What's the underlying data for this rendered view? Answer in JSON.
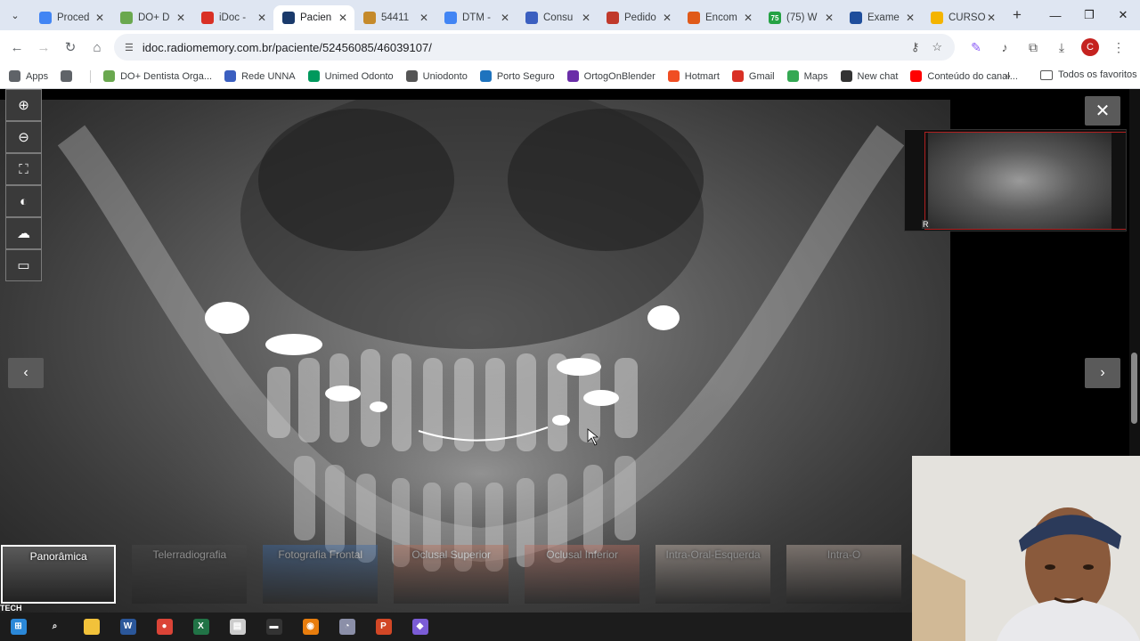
{
  "browser": {
    "tabs": [
      {
        "title": "Proced",
        "favicon": "docs-icon",
        "color": "#4285f4",
        "active": false
      },
      {
        "title": "DO+ D",
        "favicon": "tooth-icon",
        "color": "#6aa84f",
        "active": false
      },
      {
        "title": "iDoc -",
        "favicon": "gmail-icon",
        "color": "#d93025",
        "active": false
      },
      {
        "title": "Pacien",
        "favicon": "idoc-icon",
        "color": "#1a3a6b",
        "active": true
      },
      {
        "title": "54411",
        "favicon": "chart-icon",
        "color": "#c58a2b",
        "active": false
      },
      {
        "title": "DTM -",
        "favicon": "docs-icon",
        "color": "#4285f4",
        "active": false
      },
      {
        "title": "Consu",
        "favicon": "shield-icon",
        "color": "#3b5fc0",
        "active": false
      },
      {
        "title": "Pedido",
        "favicon": "flag-icon",
        "color": "#c0392b",
        "active": false
      },
      {
        "title": "Encom",
        "favicon": "mail-icon",
        "color": "#e05a1a",
        "active": false
      },
      {
        "title": "(75) W",
        "favicon": "whatsapp-icon",
        "color": "#25a244",
        "badge": "75",
        "active": false
      },
      {
        "title": "Exame",
        "favicon": "t-icon",
        "color": "#1f4e9c",
        "active": false
      },
      {
        "title": "CURSO",
        "favicon": "drive-icon",
        "color": "#f4b400",
        "active": false
      }
    ],
    "url": "idoc.radiomemory.com.br/paciente/52456085/46039107/",
    "avatar_letter": "C",
    "bookmarks": [
      {
        "label": "Apps",
        "icon": "apps-grid-icon",
        "color": "#5f6368"
      },
      {
        "label": "",
        "icon": "grid-icon",
        "color": "#5f6368"
      },
      {
        "label": "DO+ Dentista Orga...",
        "icon": "tooth-icon",
        "color": "#6aa84f"
      },
      {
        "label": "Rede UNNA",
        "icon": "shield-icon",
        "color": "#3b5fc0"
      },
      {
        "label": "Unimed Odonto",
        "icon": "unimed-icon",
        "color": "#00995d"
      },
      {
        "label": "Uniodonto",
        "icon": "globe-icon",
        "color": "#555555"
      },
      {
        "label": "Porto Seguro",
        "icon": "porto-icon",
        "color": "#1e73be"
      },
      {
        "label": "OrtogOnBlender",
        "icon": "blender-icon",
        "color": "#6a2ea8"
      },
      {
        "label": "Hotmart",
        "icon": "flame-icon",
        "color": "#f04e23"
      },
      {
        "label": "Gmail",
        "icon": "gmail-icon",
        "color": "#d93025"
      },
      {
        "label": "Maps",
        "icon": "maps-pin-icon",
        "color": "#34a853"
      },
      {
        "label": "New chat",
        "icon": "openai-icon",
        "color": "#333333"
      },
      {
        "label": "Conteúdo do canal...",
        "icon": "youtube-icon",
        "color": "#ff0000"
      }
    ],
    "bookmarks_more": "»",
    "all_bookmarks": "Todos os favoritos"
  },
  "viewer": {
    "tools": [
      {
        "name": "zoom-in-icon",
        "glyph": "⊕"
      },
      {
        "name": "zoom-out-icon",
        "glyph": "⊖"
      },
      {
        "name": "fit-screen-icon",
        "glyph": "⛶"
      },
      {
        "name": "brightness-icon",
        "glyph": "◐"
      },
      {
        "name": "download-cloud-icon",
        "glyph": "☁"
      },
      {
        "name": "ruler-icon",
        "glyph": "▭"
      }
    ],
    "close_glyph": "✕",
    "prev_glyph": "‹",
    "next_glyph": "›",
    "minimap_marker": "R",
    "thumbnails": [
      {
        "label": "Panorâmica",
        "active": true,
        "tone": "#5a5a5a"
      },
      {
        "label": "Telerradiografia",
        "active": false,
        "tone": "#4a4a4a"
      },
      {
        "label": "Fotografia Frontal",
        "active": false,
        "tone": "#3a6aa8"
      },
      {
        "label": "Oclusal Superior",
        "active": false,
        "tone": "#b86a52"
      },
      {
        "label": "Oclusal Inferior",
        "active": false,
        "tone": "#c07060"
      },
      {
        "label": "Intra-Oral-Esquerda",
        "active": false,
        "tone": "#d8c7bb"
      },
      {
        "label": "Intra-O",
        "active": false,
        "tone": "#d2bfb3"
      }
    ],
    "tech_label": "TECH"
  },
  "taskbar": [
    {
      "name": "windows-start-icon",
      "color": "#2b88d8",
      "glyph": "⊞"
    },
    {
      "name": "search-icon",
      "color": "#1c1c1c",
      "glyph": "⌕"
    },
    {
      "name": "file-explorer-icon",
      "color": "#f2c23a",
      "glyph": ""
    },
    {
      "name": "word-icon",
      "color": "#2b579a",
      "glyph": "W"
    },
    {
      "name": "chrome-icon",
      "color": "#db4437",
      "glyph": "●"
    },
    {
      "name": "excel-icon",
      "color": "#217346",
      "glyph": "X"
    },
    {
      "name": "app-icon",
      "color": "#cccccc",
      "glyph": "▤"
    },
    {
      "name": "terminal-icon",
      "color": "#333333",
      "glyph": "▬"
    },
    {
      "name": "blender-icon",
      "color": "#e87d0d",
      "glyph": "◉"
    },
    {
      "name": "app-circle-icon",
      "color": "#8b8fa8",
      "glyph": "◔"
    },
    {
      "name": "powerpoint-icon",
      "color": "#d24726",
      "glyph": "P"
    },
    {
      "name": "maps-icon",
      "color": "#7b5cd6",
      "glyph": "◆"
    }
  ]
}
